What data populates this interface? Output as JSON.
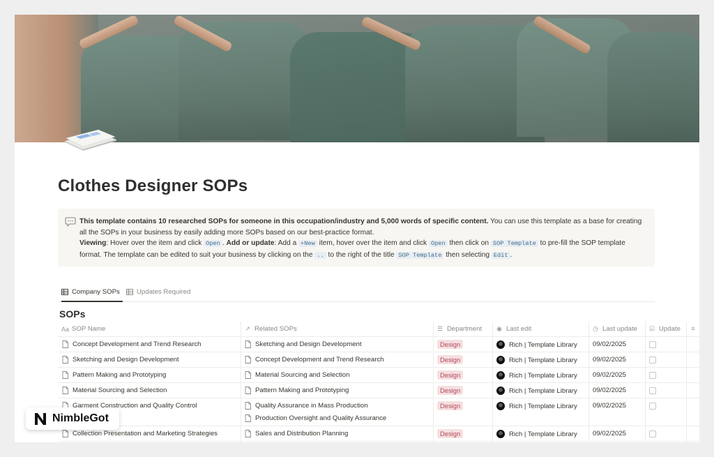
{
  "page": {
    "title": "Clothes Designer SOPs",
    "icon": "document-stack-icon"
  },
  "callout": {
    "icon": "speech-bubble-icon",
    "line1_bold": "This template contains 10 researched SOPs for someone in this occupation/industry and 5,000 words of specific content.",
    "line1_rest": " You can use this template as a base for creating all the SOPs in your business by easily adding more SOPs based on our best-practice format.",
    "viewing_label": "Viewing",
    "viewing_text": ": Hover over the item and click ",
    "open_code": "Open",
    "add_label": "Add or update",
    "add_text": ": Add a ",
    "new_code": "+New",
    "add_text2": " item, hover over the item and click ",
    "open_code2": "Open",
    "add_text3": " then click on ",
    "sop_template_code": "SOP Template",
    "add_text4": " to pre-fill the SOP template format. The template can be edited to suit your business by clicking on the ",
    "dots_code": "..",
    "add_text5": " to the right of the title ",
    "sop_template_code2": "SOP Template",
    "add_text6": " then selecting ",
    "edit_code": "Edit",
    "add_text7": "."
  },
  "tabs": [
    {
      "label": "Company SOPs",
      "active": true
    },
    {
      "label": "Updates Required",
      "active": false
    }
  ],
  "database": {
    "title": "SOPs",
    "columns": {
      "name": "SOP Name",
      "related": "Related SOPs",
      "department": "Department",
      "last_edit": "Last edit",
      "last_update": "Last update",
      "update": "Update"
    },
    "rows": [
      {
        "name": "Concept Development and Trend Research",
        "related": [
          "Sketching and Design Development"
        ],
        "department": "Design",
        "editor": "Rich | Template Library",
        "date": "09/02/2025"
      },
      {
        "name": "Sketching and Design Development",
        "related": [
          "Concept Development and Trend Research"
        ],
        "department": "Design",
        "editor": "Rich | Template Library",
        "date": "09/02/2025"
      },
      {
        "name": "Pattern Making and Prototyping",
        "related": [
          "Material Sourcing and Selection"
        ],
        "department": "Design",
        "editor": "Rich | Template Library",
        "date": "09/02/2025"
      },
      {
        "name": "Material Sourcing and Selection",
        "related": [
          "Pattern Making and Prototyping"
        ],
        "department": "Design",
        "editor": "Rich | Template Library",
        "date": "09/02/2025"
      },
      {
        "name": "Garment Construction and Quality Control",
        "related": [
          "Quality Assurance in Mass Production",
          "Production Oversight and Quality Assurance"
        ],
        "department": "Design",
        "editor": "Rich | Template Library",
        "date": "09/02/2025"
      },
      {
        "name": "Collection Presentation and Marketing Strategies",
        "related": [
          "Sales and Distribution Planning"
        ],
        "department": "Design",
        "editor": "Rich | Template Library",
        "date": "09/02/2025"
      }
    ]
  },
  "watermark": {
    "brand": "NimbleGot"
  }
}
